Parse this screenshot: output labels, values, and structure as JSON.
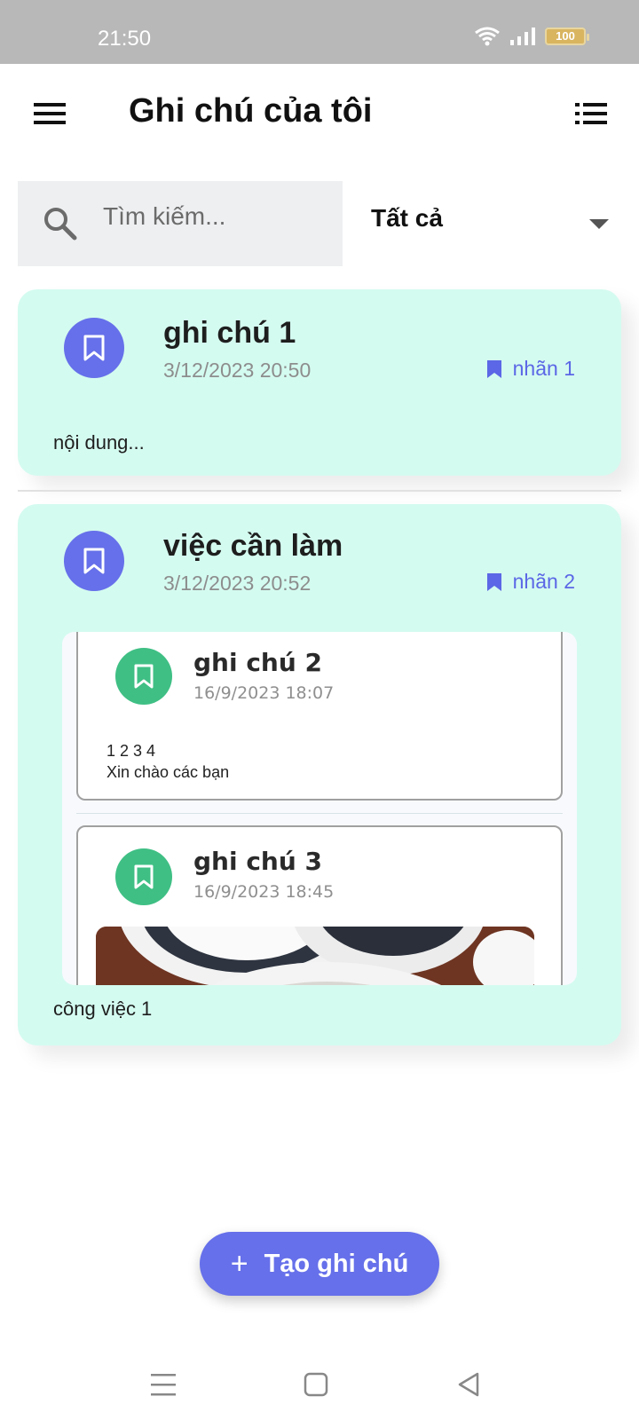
{
  "status_bar": {
    "time": "21:50",
    "battery": "100"
  },
  "app_bar": {
    "title": "Ghi chú của tôi"
  },
  "search": {
    "placeholder": "Tìm kiếm..."
  },
  "filter": {
    "selected": "Tất cả"
  },
  "notes": [
    {
      "title": "ghi chú 1",
      "date": "3/12/2023 20:50",
      "label": "nhãn 1",
      "body": "nội dung..."
    },
    {
      "title": "việc cần làm",
      "date": "3/12/2023 20:52",
      "label": "nhãn 2",
      "body": "công việc 1",
      "children": [
        {
          "title": "ghi chú 2",
          "date": "16/9/2023 18:07",
          "body_line1": "1 2 3 4",
          "body_line2": "Xin chào các bạn"
        },
        {
          "title": "ghi chú 3",
          "date": "16/9/2023 18:45"
        }
      ]
    }
  ],
  "fab": {
    "label": "Tạo ghi chú"
  },
  "colors": {
    "accent": "#6670ea",
    "card_bg": "#d4fbf0",
    "child_badge": "#3fbf84"
  }
}
